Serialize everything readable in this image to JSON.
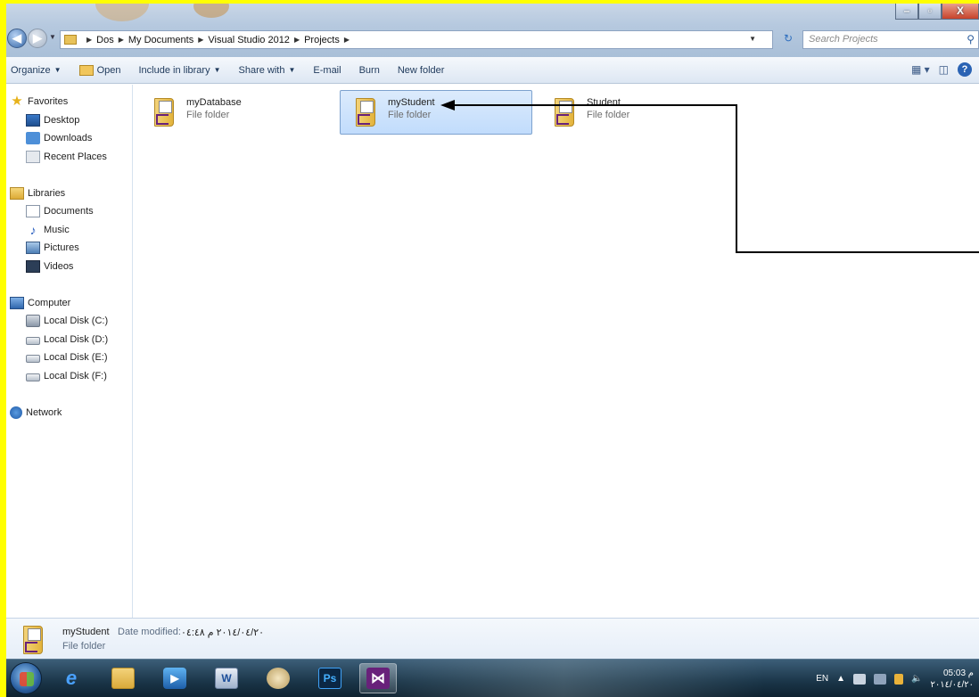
{
  "window": {
    "title_buttons": {
      "minimize": "–",
      "maximize": "▫",
      "close": "X"
    }
  },
  "address_bar": {
    "breadcrumbs": [
      "Dos",
      "My Documents",
      "Visual Studio 2012",
      "Projects"
    ],
    "search_placeholder": "Search Projects"
  },
  "toolbar": {
    "organize": "Organize",
    "open": "Open",
    "include_in_library": "Include in library",
    "share_with": "Share with",
    "email": "E-mail",
    "burn": "Burn",
    "new_folder": "New folder"
  },
  "nav_pane": {
    "favorites": {
      "label": "Favorites",
      "items": [
        "Desktop",
        "Downloads",
        "Recent Places"
      ]
    },
    "libraries": {
      "label": "Libraries",
      "items": [
        "Documents",
        "Music",
        "Pictures",
        "Videos"
      ]
    },
    "computer": {
      "label": "Computer",
      "items": [
        "Local Disk (C:)",
        "Local Disk (D:)",
        "Local Disk (E:)",
        "Local Disk (F:)"
      ]
    },
    "network": {
      "label": "Network"
    }
  },
  "files": [
    {
      "name": "myDatabase",
      "type": "File folder",
      "selected": false
    },
    {
      "name": "myStudent",
      "type": "File folder",
      "selected": true
    },
    {
      "name": "Student",
      "type": "File folder",
      "selected": false
    }
  ],
  "details": {
    "name": "myStudent",
    "date_label": "Date modified:",
    "date_value": "٢٠١٤/٠٤/٢٠ م ٠٤:٤٨",
    "type": "File folder"
  },
  "taskbar": {
    "apps": [
      {
        "icon": "internet-explorer-icon",
        "glyph": "e"
      },
      {
        "icon": "file-explorer-icon",
        "glyph": ""
      },
      {
        "icon": "media-player-icon",
        "glyph": "▶"
      },
      {
        "icon": "word-icon",
        "glyph": "W"
      },
      {
        "icon": "paint-icon",
        "glyph": ""
      },
      {
        "icon": "photoshop-icon",
        "glyph": "Ps"
      },
      {
        "icon": "visual-studio-icon",
        "glyph": "⋈"
      }
    ],
    "language": "EN",
    "tray_arrow": "▲",
    "time": "05:03 م",
    "date": "٢٠١٤/٠٤/٢٠"
  },
  "colors": {
    "page_border": "#ffff00",
    "selection": "#cce4ff",
    "vs_purple": "#68217a"
  }
}
